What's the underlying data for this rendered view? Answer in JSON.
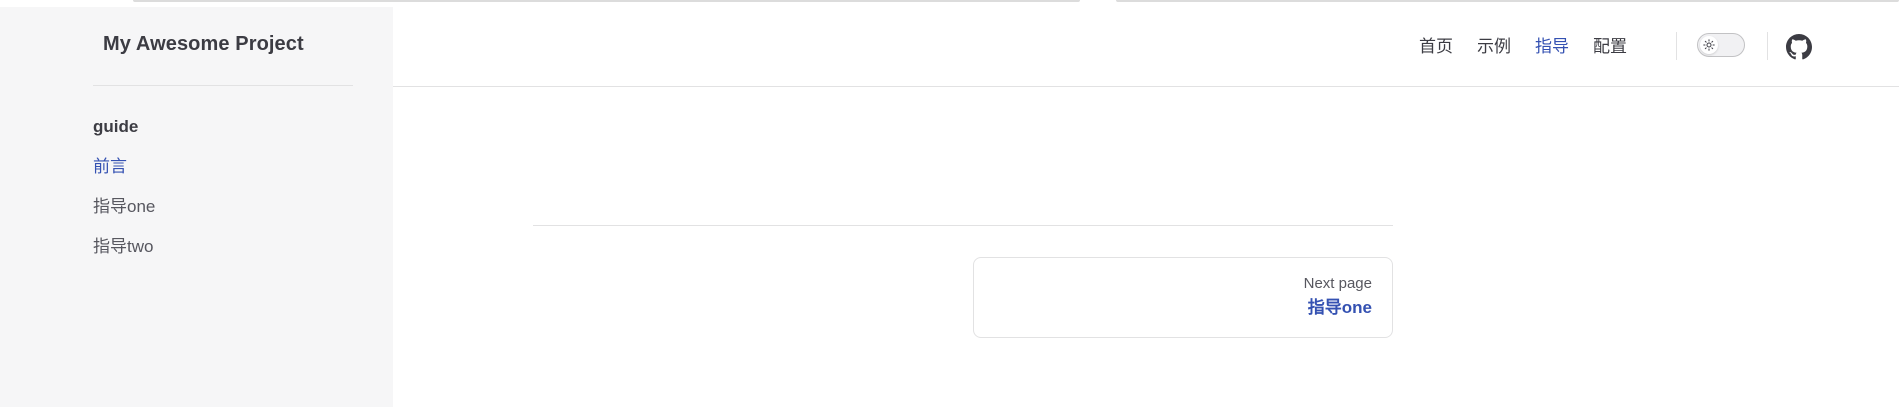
{
  "site": {
    "title": "My Awesome Project"
  },
  "sidebar": {
    "section_title": "guide",
    "items": [
      {
        "label": "前言",
        "active": true
      },
      {
        "label": "指导one",
        "active": false
      },
      {
        "label": "指导two",
        "active": false
      }
    ]
  },
  "nav": {
    "links": [
      {
        "label": "首页",
        "active": false
      },
      {
        "label": "示例",
        "active": false
      },
      {
        "label": "指导",
        "active": true
      },
      {
        "label": "配置",
        "active": false
      }
    ],
    "theme_toggle": {
      "icon": "sun-icon",
      "state": "light"
    },
    "social": {
      "icon": "github-icon"
    }
  },
  "pager": {
    "next_desc": "Next page",
    "next_title": "指导one"
  },
  "colors": {
    "brand": "#3451b2",
    "sidebar_bg": "#f6f6f7",
    "text": "#3c3c43",
    "divider": "#e2e2e3"
  }
}
